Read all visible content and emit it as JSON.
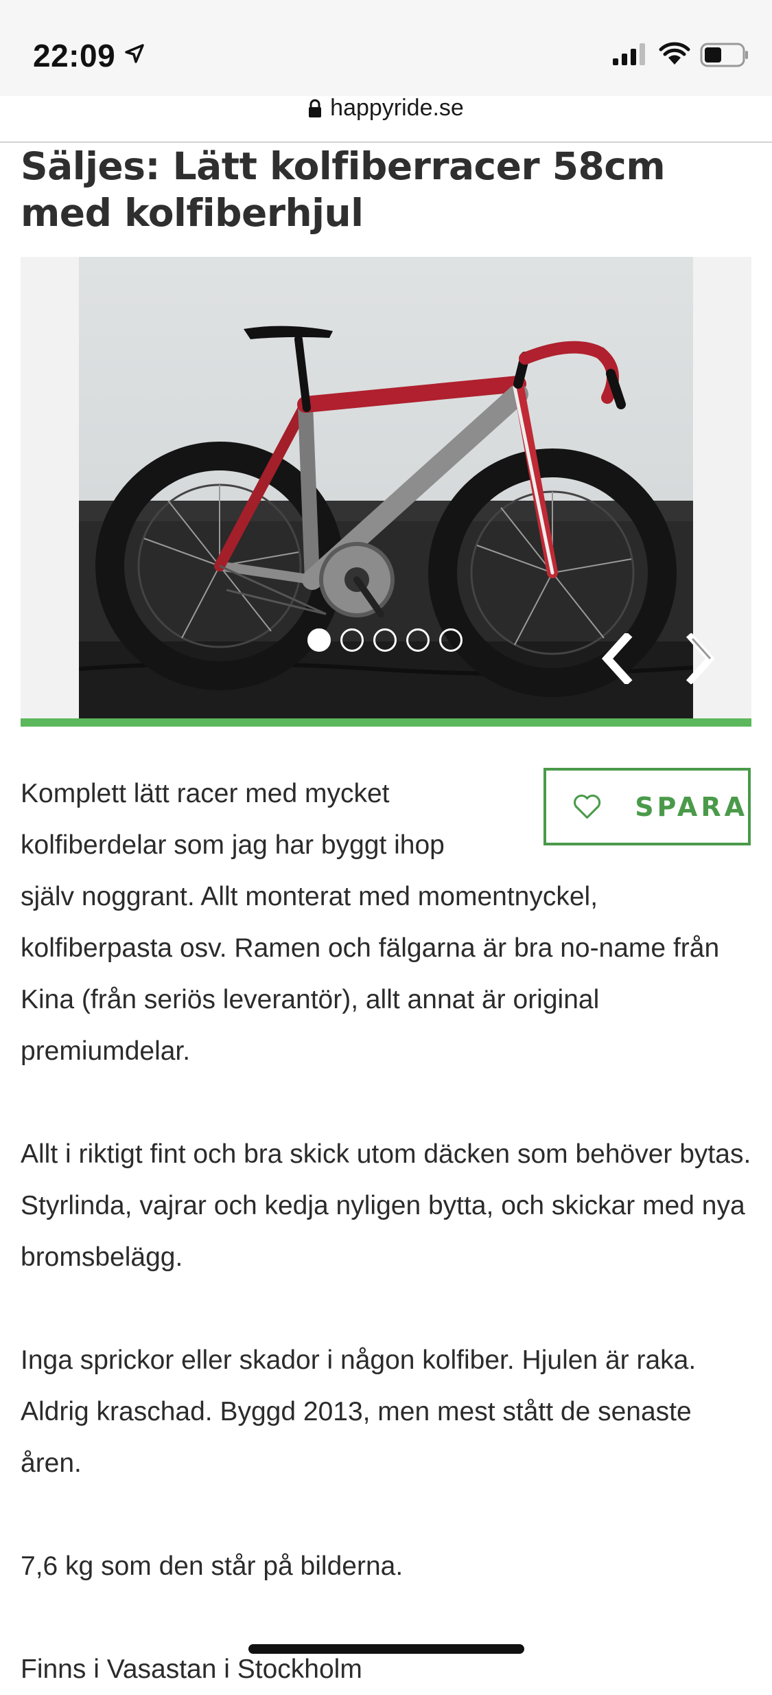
{
  "status_bar": {
    "time": "22:09",
    "icons": [
      "location-arrow-icon",
      "cellular-signal-icon",
      "wifi-icon",
      "battery-icon"
    ]
  },
  "browser": {
    "url": "happyride.se",
    "lock_icon": "lock-icon"
  },
  "listing": {
    "title": "Säljes: Lätt kolfiberracer 58cm med kolfiberhjul",
    "gallery": {
      "image_count": 5,
      "active_index": 0,
      "progress": 1.0,
      "accent_color": "#5cb85c"
    },
    "save_button": {
      "label": "SPARA",
      "icon": "heart-icon",
      "color": "#4a9a4a"
    },
    "description": {
      "p1_line1": "Komplett lätt racer med mycket",
      "p1_line2": "kolfiberdelar som jag har byggt ihop",
      "p1_rest": "själv noggrant. Allt monterat med momentnyckel, kolfiberpasta osv. Ramen och fälgarna är bra no-name från Kina (från seriös leverantör), allt annat är original premiumdelar.",
      "p2": "Allt i riktigt fint och bra skick utom däcken som behöver bytas. Styrlinda, vajrar och kedja nyligen bytta, och skickar med nya bromsbelägg.",
      "p3": "Inga sprickor eller skador i någon kolfiber. Hjulen är raka. Aldrig kraschad. Byggd 2013, men mest stått de senaste åren.",
      "p4": "7,6 kg som den står på bilderna.",
      "p5": "Finns i Vasastan i Stockholm"
    }
  }
}
